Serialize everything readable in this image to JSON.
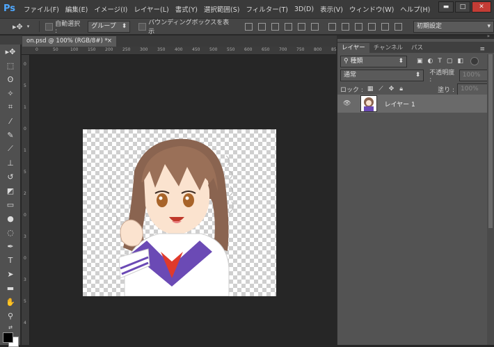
{
  "app": {
    "logo": "Ps"
  },
  "menu": [
    "ファイル(F)",
    "編集(E)",
    "イメージ(I)",
    "レイヤー(L)",
    "書式(Y)",
    "選択範囲(S)",
    "フィルター(T)",
    "3D(D)",
    "表示(V)",
    "ウィンドウ(W)",
    "ヘルプ(H)"
  ],
  "window_controls": {
    "minimize": "▬",
    "maximize": "□",
    "close": "✕"
  },
  "options": {
    "auto_select_label": "自動選択 :",
    "auto_select_value": "グループ",
    "bounding_box_label": "バウンディングボックスを表示",
    "workspace_value": "初期設定"
  },
  "document": {
    "tab_title": "on.psd @ 100% (RGB/8#) *",
    "tab_close": "×"
  },
  "ruler_top_ticks": [
    "0",
    "50",
    "100",
    "150",
    "200",
    "250",
    "300",
    "350",
    "400",
    "450",
    "500",
    "550",
    "600",
    "650",
    "700",
    "750",
    "800",
    "850"
  ],
  "ruler_left_ticks": [
    "0",
    "5",
    "1",
    "0",
    "1",
    "5",
    "2",
    "0",
    "3",
    "0",
    "3",
    "5",
    "4"
  ],
  "panel": {
    "tabs": [
      "レイヤー",
      "チャンネル",
      "パス"
    ],
    "filter_label": "種類",
    "blend_mode": "通常",
    "opacity_label": "不透明度 :",
    "opacity_value": "100%",
    "lock_label": "ロック :",
    "fill_label": "塗り :",
    "fill_value": "100%",
    "layer_name": "レイヤー 1"
  },
  "colors": {
    "menubar": "#3a3a3a",
    "workspace": "#262626",
    "panel": "#535353",
    "accent": "#4fa8ff"
  },
  "icons": [
    "move-tool-icon",
    "marquee-tool-icon",
    "lasso-tool-icon",
    "magic-wand-icon",
    "crop-tool-icon",
    "eyedropper-icon",
    "healing-brush-icon",
    "brush-tool-icon",
    "clone-stamp-icon",
    "history-brush-icon",
    "eraser-icon",
    "gradient-icon",
    "blur-icon",
    "dodge-icon",
    "pen-tool-icon",
    "type-tool-icon",
    "path-select-icon",
    "rectangle-tool-icon",
    "hand-tool-icon",
    "zoom-tool-icon",
    "eye-icon"
  ]
}
